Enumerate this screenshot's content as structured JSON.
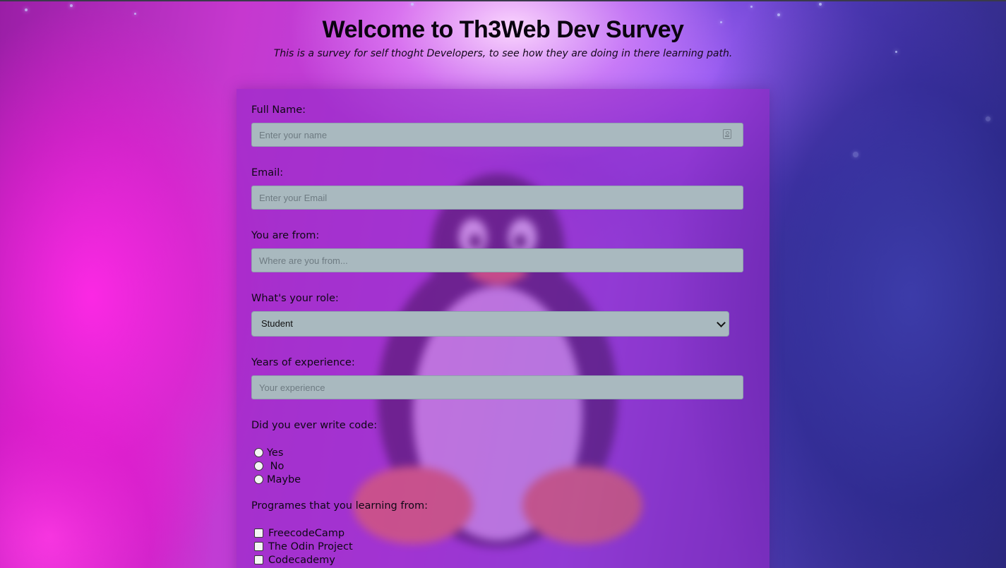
{
  "header": {
    "title": "Welcome to Th3Web Dev Survey",
    "description": "This is a survey for self thoght Developers, to see how they are doing in there learning path."
  },
  "form": {
    "name": {
      "label": "Full Name:",
      "placeholder": "Enter your name",
      "value": ""
    },
    "email": {
      "label": "Email:",
      "placeholder": "Enter your Email",
      "value": ""
    },
    "location": {
      "label": "You are from:",
      "placeholder": "Where are you from...",
      "value": ""
    },
    "role": {
      "label": "What's your role:",
      "selected": "Student"
    },
    "experience": {
      "label": "Years of experience:",
      "placeholder": "Your experience",
      "value": ""
    },
    "wrote_code": {
      "label": "Did you ever write code:",
      "options": [
        {
          "label": "Yes",
          "checked": false
        },
        {
          "label": " No",
          "checked": false
        },
        {
          "label": "Maybe",
          "checked": false
        }
      ]
    },
    "programs": {
      "label": "Programes that you learning from:",
      "options": [
        {
          "label": "FreecodeCamp",
          "checked": false
        },
        {
          "label": "The Odin Project",
          "checked": false
        },
        {
          "label": "Codecademy",
          "checked": false
        }
      ]
    }
  },
  "icons": {
    "name_field_icon": "contact-card-icon",
    "role_dropdown_icon": "chevron-down-icon"
  },
  "colors": {
    "card_background": "#9628c8",
    "input_background": "#a9b9bf",
    "text": "#0e0715"
  }
}
